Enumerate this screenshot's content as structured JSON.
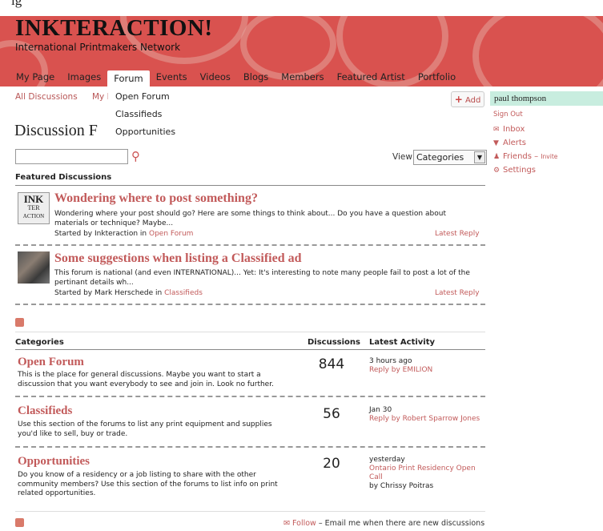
{
  "page": {
    "crop_text": "ig"
  },
  "header": {
    "brand": "INKTERACTION!",
    "tagline": "International Printmakers Network"
  },
  "nav": {
    "items": [
      "My Page",
      "Images",
      "Forum",
      "Events",
      "Videos",
      "Blogs",
      "Members",
      "Featured Artist",
      "Portfolio"
    ],
    "active": "Forum"
  },
  "dropdown": {
    "items": [
      "Open Forum",
      "Classifieds",
      "Opportunities"
    ]
  },
  "subnav": {
    "all_discussions": "All Discussions",
    "my": "My D"
  },
  "title": "Discussion F",
  "add_button": "Add",
  "view": {
    "label": "View",
    "selected": "Categories"
  },
  "featured": {
    "label": "Featured Discussions",
    "thumb1_text": [
      "INK",
      "TER",
      "ACTION"
    ],
    "items": [
      {
        "title": "Wondering where to post something?",
        "body": "Wondering where your post should go? Here are some things to think about... Do you have a question about materials or technique? Maybe...",
        "started_by": "Started by Inkteraction in",
        "forum": "Open Forum",
        "latest": "Latest Reply"
      },
      {
        "title": "Some suggestions when listing a Classified ad",
        "body": "This forum is national (and even INTERNATIONAL)... Yet: It's interesting to note many people fail to post a lot of the pertinant details wh...",
        "started_by": "Started by Mark Herschede in",
        "forum": "Classifieds",
        "latest": "Latest Reply"
      }
    ]
  },
  "categories": {
    "headers": {
      "name": "Categories",
      "discussions": "Discussions",
      "latest": "Latest Activity"
    },
    "items": [
      {
        "title": "Open Forum",
        "desc": "This is the place for general discussions. Maybe you want to start a discussion that you want everybody to see and join in. Look no further.",
        "count": "844",
        "time": "3 hours ago",
        "reply": "Reply by EMILION",
        "by": ""
      },
      {
        "title": "Classifieds",
        "desc": "Use this section of the forums to list any print equipment and supplies you'd like to sell, buy or trade.",
        "count": "56",
        "time": "Jan 30",
        "reply": "Reply by Robert Sparrow Jones",
        "by": ""
      },
      {
        "title": "Opportunities",
        "desc": "Do you know of a residency or a job listing to share with the other community members? Use this section of the forums to list info on print related opportunities.",
        "count": "20",
        "time": "yesterday",
        "reply": "Ontario Print Residency Open Call",
        "by": "by Chrissy Poitras"
      }
    ]
  },
  "follow": {
    "link": "Follow",
    "text": " – Email me when there are new discussions"
  },
  "sidebar": {
    "name": "paul thompson",
    "sign_out": "Sign Out",
    "inbox": "Inbox",
    "alerts": "Alerts",
    "friends": "Friends",
    "invite": "Invite",
    "settings": "Settings"
  }
}
